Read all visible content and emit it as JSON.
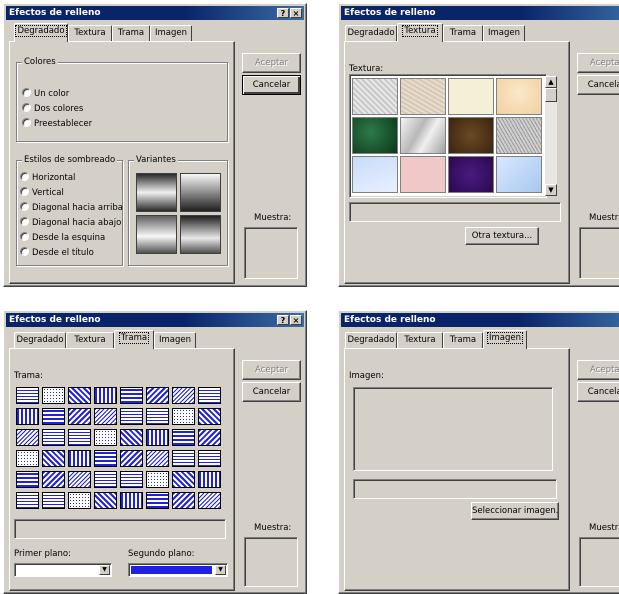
{
  "window_title": "Efectos de relleno",
  "help_glyph": "?",
  "close_glyph": "×",
  "tabs": [
    "Degradado",
    "Textura",
    "Trama",
    "Imagen"
  ],
  "buttons": {
    "accept": "Aceptar",
    "cancel": "Cancelar"
  },
  "sample_label": "Muestra:",
  "gradient": {
    "colors_group": "Colores",
    "color_options": [
      "Un color",
      "Dos colores",
      "Preestablecer"
    ],
    "shading_group": "Estilos de sombreado",
    "shading_options": [
      "Horizontal",
      "Vertical",
      "Diagonal hacia arriba",
      "Diagonal hacia abajo",
      "Desde la esquina",
      "Desde el título"
    ],
    "variants_group": "Variantes"
  },
  "texture": {
    "label": "Textura:",
    "other_button": "Otra textura..."
  },
  "pattern": {
    "label": "Trama:",
    "foreground_label": "Primer plano:",
    "background_label": "Segundo plano:"
  },
  "picture": {
    "label": "Imagen:",
    "select_button": "Seleccionar imagen..."
  }
}
